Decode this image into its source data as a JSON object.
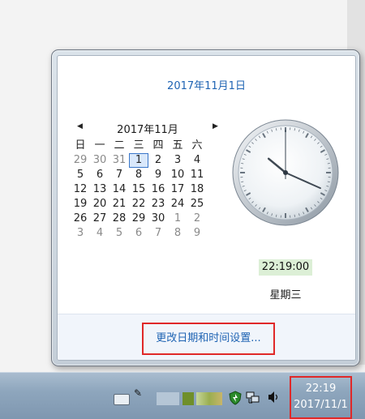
{
  "popup": {
    "date_header": "2017年11月1日",
    "calendar": {
      "month_title": "2017年11月",
      "prev_glyph": "◀",
      "next_glyph": "▶",
      "weekdays": [
        "日",
        "一",
        "二",
        "三",
        "四",
        "五",
        "六"
      ],
      "days": [
        [
          "29",
          "30",
          "31",
          "1",
          "2",
          "3",
          "4"
        ],
        [
          "5",
          "6",
          "7",
          "8",
          "9",
          "10",
          "11"
        ],
        [
          "12",
          "13",
          "14",
          "15",
          "16",
          "17",
          "18"
        ],
        [
          "19",
          "20",
          "21",
          "22",
          "23",
          "24",
          "25"
        ],
        [
          "26",
          "27",
          "28",
          "29",
          "30",
          "1",
          "2"
        ],
        [
          "3",
          "4",
          "5",
          "6",
          "7",
          "8",
          "9"
        ]
      ],
      "today": "1"
    },
    "clock": {
      "hour": 22,
      "minute": 19,
      "second": 0
    },
    "time_text": "22:19:00",
    "weekday_text": "星期三",
    "change_settings_link": "更改日期和时间设置..."
  },
  "taskbar": {
    "time": "22:19",
    "date": "2017/11/1",
    "icons": [
      "keyboard-icon",
      "pen-icon",
      "app-icon",
      "app-icon",
      "app-icon",
      "shield-icon",
      "network-icon",
      "volume-icon"
    ],
    "accent": "#e02828"
  }
}
